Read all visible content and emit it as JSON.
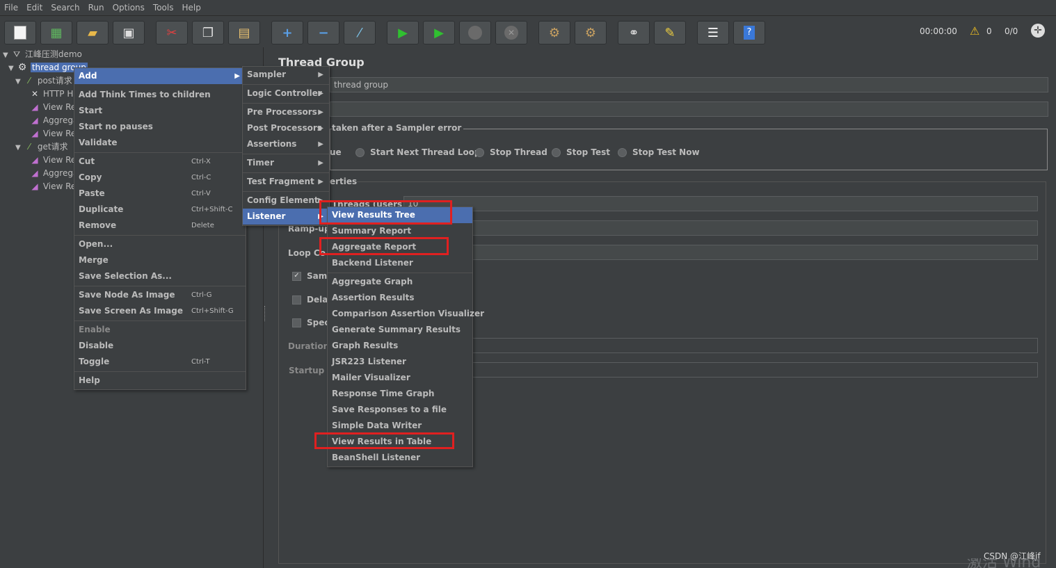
{
  "menubar": [
    "File",
    "Edit",
    "Search",
    "Run",
    "Options",
    "Tools",
    "Help"
  ],
  "toolbar": {
    "buttons": [
      "new-icon",
      "templates-icon",
      "open-icon",
      "save-icon",
      "cut-icon",
      "copy-icon",
      "paste-icon",
      "expand-icon",
      "collapse-icon",
      "toggle-icon",
      "start-icon",
      "start-no-pauses-icon",
      "stop-icon",
      "shutdown-icon",
      "clear-icon",
      "clear-all-icon",
      "search-icon",
      "reset-search-icon",
      "function-helper-icon",
      "help-icon"
    ],
    "timer": "00:00:00",
    "warnings": "0",
    "threads": "0/0"
  },
  "tree": {
    "root": "江峰压测demo",
    "thread_group": "thread group",
    "post": "post请求",
    "http": "HTTP H",
    "view1": "View Re",
    "agg1": "Aggrega",
    "view2": "View Re",
    "get": "get请求",
    "view3": "View Re",
    "agg2": "Aggrega",
    "view4": "View Re"
  },
  "panel": {
    "title": "Thread Group",
    "name_value": "thread group",
    "comments_value": "",
    "action_group_label": "taken after a Sampler error",
    "radio_partial": "ue",
    "radios": [
      "Start Next Thread Loop",
      "Stop Thread",
      "Stop Test",
      "Stop Test Now"
    ],
    "properties_label": "erties",
    "threads_label": "Threads (users):",
    "threads_value": "10",
    "rampup_label": "Ramp-up |",
    "loop_label": "Loop Co",
    "same_label": "Same",
    "delay_label": "Delay",
    "spec_label": "Spec",
    "duration_label": "Duration (",
    "startup_label": "Startup de"
  },
  "context_menu": {
    "add": "Add",
    "add_think": "Add Think Times to children",
    "start": "Start",
    "start_no_pauses": "Start no pauses",
    "validate": "Validate",
    "cut": "Cut",
    "cut_sc": "Ctrl-X",
    "copy": "Copy",
    "copy_sc": "Ctrl-C",
    "paste": "Paste",
    "paste_sc": "Ctrl-V",
    "duplicate": "Duplicate",
    "duplicate_sc": "Ctrl+Shift-C",
    "remove": "Remove",
    "remove_sc": "Delete",
    "open": "Open...",
    "merge": "Merge",
    "save_selection": "Save Selection As...",
    "save_node_image": "Save Node As Image",
    "save_node_image_sc": "Ctrl-G",
    "save_screen_image": "Save Screen As Image",
    "save_screen_image_sc": "Ctrl+Shift-G",
    "enable": "Enable",
    "disable": "Disable",
    "toggle": "Toggle",
    "toggle_sc": "Ctrl-T",
    "help": "Help"
  },
  "add_submenu": [
    "Sampler",
    "Logic Controller",
    "Pre Processors",
    "Post Processors",
    "Assertions",
    "Timer",
    "Test Fragment",
    "Config Element",
    "Listener"
  ],
  "listener_submenu": [
    "View Results Tree",
    "Summary Report",
    "Aggregate Report",
    "Backend Listener",
    "Aggregate Graph",
    "Assertion Results",
    "Comparison Assertion Visualizer",
    "Generate Summary Results",
    "Graph Results",
    "JSR223 Listener",
    "Mailer Visualizer",
    "Response Time Graph",
    "Save Responses to a file",
    "Simple Data Writer",
    "View Results in Table",
    "BeanShell Listener"
  ],
  "watermark": "CSDN @江峰jf",
  "activate_partial": "激活 Wind",
  "colors": {
    "highlight": "#4b6eaf",
    "redbox": "#e02020",
    "background": "#3c3f41"
  }
}
